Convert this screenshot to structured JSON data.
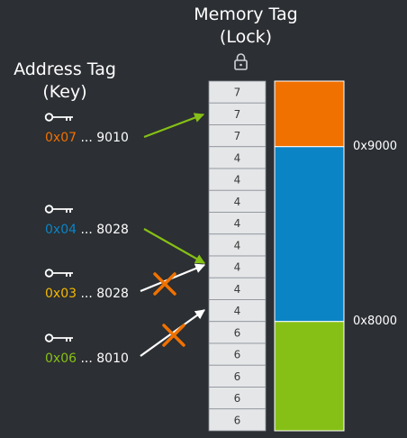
{
  "memory_tag_title": [
    "Memory Tag",
    "(Lock)"
  ],
  "address_tag_title": [
    "Address Tag",
    "(Key)"
  ],
  "memory_cells": [
    "7",
    "7",
    "7",
    "4",
    "4",
    "4",
    "4",
    "4",
    "4",
    "4",
    "4",
    "6",
    "6",
    "6",
    "6",
    "6"
  ],
  "regions": [
    {
      "tag": "7",
      "color": "#f07100"
    },
    {
      "tag": "4",
      "color": "#0b84c6"
    },
    {
      "tag": "6",
      "color": "#86c016"
    }
  ],
  "address_labels": [
    "0x9000",
    "0x8000"
  ],
  "keys": [
    {
      "tag": "0x07",
      "suffix": " ... 9010",
      "color": "#f07100",
      "arrow_color": "#86c016",
      "blocked": false
    },
    {
      "tag": "0x04",
      "suffix": " ... 8028",
      "color": "#0b84c6",
      "arrow_color": "#86c016",
      "blocked": false
    },
    {
      "tag": "0x03",
      "suffix": " ... 8028",
      "color": "#f5b800",
      "arrow_color": "#ffffff",
      "blocked": true
    },
    {
      "tag": "0x06",
      "suffix": " ... 8010",
      "color": "#86c016",
      "arrow_color": "#ffffff",
      "blocked": true
    }
  ],
  "colors": {
    "background": "#2c2f33",
    "cell_fill": "#e4e6e8",
    "cross": "#f07100"
  },
  "icons": {
    "lock": "lock-icon",
    "key": "key-icon",
    "cross": "cross-icon"
  }
}
